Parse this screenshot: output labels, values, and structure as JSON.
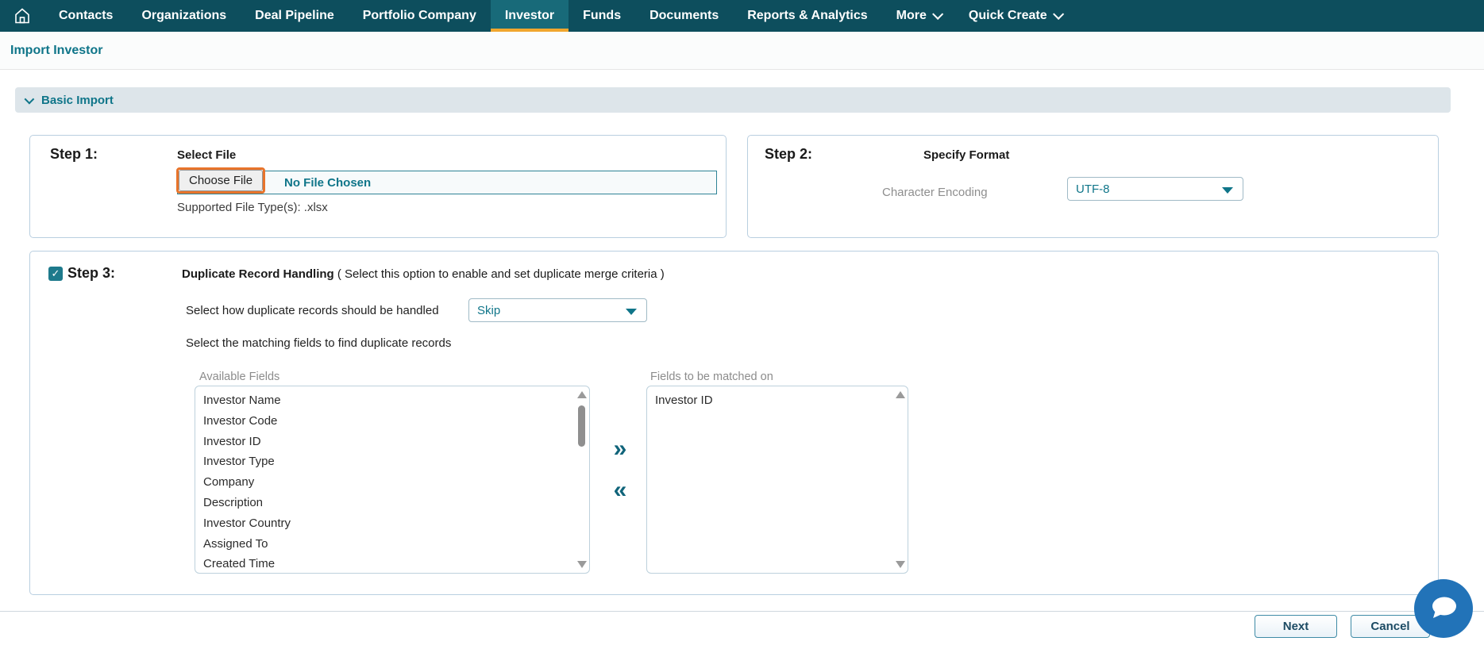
{
  "nav": {
    "items": [
      {
        "label": "Contacts",
        "active": false
      },
      {
        "label": "Organizations",
        "active": false
      },
      {
        "label": "Deal Pipeline",
        "active": false
      },
      {
        "label": "Portfolio Company",
        "active": false
      },
      {
        "label": "Investor",
        "active": true
      },
      {
        "label": "Funds",
        "active": false
      },
      {
        "label": "Documents",
        "active": false
      },
      {
        "label": "Reports & Analytics",
        "active": false
      }
    ],
    "more_label": "More",
    "quick_create_label": "Quick Create"
  },
  "page": {
    "title": "Import Investor"
  },
  "accordion": {
    "label": "Basic Import"
  },
  "step1": {
    "label": "Step 1:",
    "title": "Select File",
    "choose_file_label": "Choose File",
    "file_status": "No File Chosen",
    "supported_text": "Supported File Type(s): .xlsx"
  },
  "step2": {
    "label": "Step 2:",
    "title": "Specify Format",
    "encoding_label": "Character Encoding",
    "encoding_value": "UTF-8"
  },
  "step3": {
    "label": "Step 3:",
    "checkbox_checked": "✓",
    "title": "Duplicate Record Handling",
    "subtitle": " ( Select this option to enable and set duplicate merge criteria )",
    "handled_label": "Select how duplicate records should be handled",
    "handled_value": "Skip",
    "matching_label": "Select the matching fields to find duplicate records",
    "available_label": "Available Fields",
    "available_fields": [
      "Investor Name",
      "Investor Code",
      "Investor ID",
      "Investor Type",
      "Company",
      "Description",
      "Investor Country",
      "Assigned To",
      "Created Time"
    ],
    "matched_label": "Fields to be matched on",
    "matched_fields": [
      "Investor ID"
    ],
    "move_right_glyph": "»",
    "move_left_glyph": "«"
  },
  "footer": {
    "next_label": "Next",
    "cancel_label": "Cancel"
  },
  "colors": {
    "nav_bg": "#0d4e5d",
    "nav_active_bg": "#186a79",
    "active_tab_underline": "#f0a62e",
    "accent_teal": "#0f7589",
    "choose_file_highlight": "#e8742b",
    "chat_bubble": "#2273b8",
    "button_border": "#3f8ba6",
    "button_text": "#1c4a63"
  }
}
